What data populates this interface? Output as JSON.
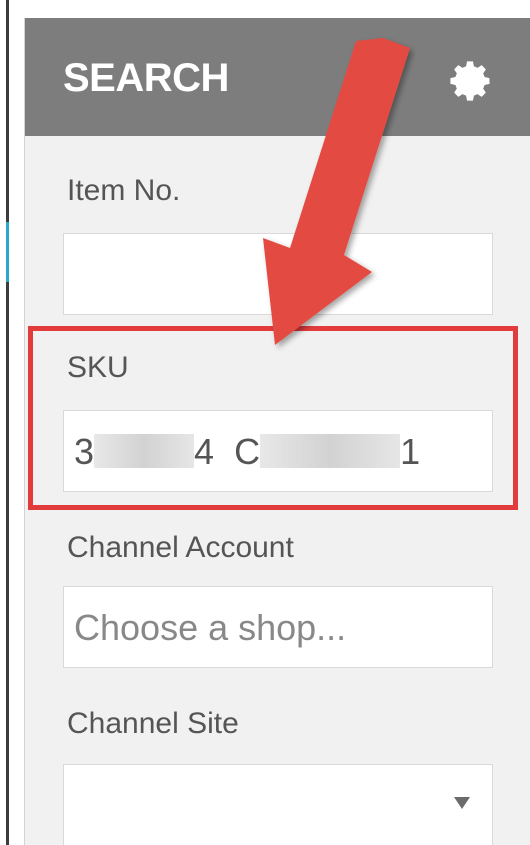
{
  "panel": {
    "title": "SEARCH",
    "settings_icon": "gear-icon"
  },
  "fields": {
    "item_no": {
      "label": "Item No.",
      "value": ""
    },
    "sku": {
      "label": "SKU",
      "value_start": "3",
      "value_mid1": "4",
      "value_mid2": "C",
      "value_end": "1"
    },
    "channel_account": {
      "label": "Channel Account",
      "placeholder": "Choose a shop..."
    },
    "channel_site": {
      "label": "Channel Site",
      "value": "",
      "dropdown_icon": "caret-down-icon"
    }
  },
  "annotation": {
    "color": "#e23b3b",
    "arrow_icon": "red-arrow-icon"
  }
}
